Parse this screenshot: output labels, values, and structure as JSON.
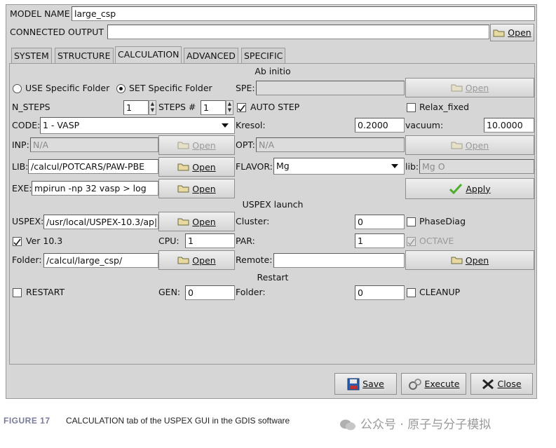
{
  "header": {
    "model_name_label": "MODEL NAME",
    "model_name_value": "large_csp",
    "connected_output_label": "CONNECTED OUTPUT",
    "connected_output_value": "",
    "open_label": "Open"
  },
  "tabs": [
    {
      "label": "SYSTEM"
    },
    {
      "label": "STRUCTURE"
    },
    {
      "label": "CALCULATION",
      "active": true
    },
    {
      "label": "ADVANCED"
    },
    {
      "label": "SPECIFIC"
    }
  ],
  "ab_initio": {
    "title": "Ab initio",
    "use_specific_folder": "USE Specific Folder",
    "set_specific_folder": "SET Specific Folder",
    "selected_folder_mode": "SET Specific Folder",
    "spe_label": "SPE:",
    "spe_value": "",
    "spe_open": "Open",
    "n_steps_label": "N_STEPS",
    "n_steps_value": "1",
    "steps_label": "STEPS #",
    "steps_value": "1",
    "auto_step_label": "AUTO STEP",
    "auto_step_checked": true,
    "relax_fixed_label": "Relax_fixed",
    "relax_fixed_checked": false,
    "code_label": "CODE:",
    "code_value": "1  - VASP",
    "kresol_label": "Kresol:",
    "kresol_value": "0.2000",
    "vacuum_label": "vacuum:",
    "vacuum_value": "10.0000",
    "inp_label": "INP:",
    "inp_value": "N/A",
    "inp_open": "Open",
    "opt_label": "OPT:",
    "opt_value": "N/A",
    "opt_open": "Open",
    "lib_label": "LIB:",
    "lib_value": "/calcul/POTCARS/PAW-PBE",
    "lib_open": "Open",
    "flavor_label": "FLAVOR:",
    "flavor_value": "Mg",
    "lib2_label": "lib:",
    "lib2_value": "Mg O",
    "exe_label": "EXE:",
    "exe_value": "mpirun -np 32 vasp > log",
    "exe_open": "Open",
    "apply_label": "Apply"
  },
  "uspex_launch": {
    "title": "USPEX launch",
    "uspex_label": "USPEX:",
    "uspex_value": "/usr/local/USPEX-10.3/ap|",
    "uspex_open": "Open",
    "cluster_label": "Cluster:",
    "cluster_value": "0",
    "phasediag_label": "PhaseDiag",
    "phasediag_checked": false,
    "ver_label": "Ver 10.3",
    "ver_checked": true,
    "cpu_label": "CPU:",
    "cpu_value": "1",
    "par_label": "PAR:",
    "par_value": "1",
    "octave_label": "OCTAVE",
    "octave_checked": true,
    "folder_label": "Folder:",
    "folder_value": "/calcul/large_csp/",
    "folder_open": "Open",
    "remote_label": "Remote:",
    "remote_value": "",
    "remote_open": "Open"
  },
  "restart": {
    "title": "Restart",
    "restart_label": "RESTART",
    "restart_checked": false,
    "gen_label": "GEN:",
    "gen_value": "0",
    "folder_label": "Folder:",
    "folder_value": "0",
    "cleanup_label": "CLEANUP",
    "cleanup_checked": false
  },
  "footer_buttons": {
    "save": "Save",
    "execute": "Execute",
    "close": "Close"
  },
  "caption": {
    "figure": "FIGURE 17",
    "text": "CALCULATION tab of the USPEX GUI in the GDIS software"
  },
  "watermark": "公众号 · 原子与分子模拟",
  "colors": {
    "panel": "#d6d6d6",
    "caption_label": "#7a7a9a",
    "apply_check": "#4caf2a"
  }
}
